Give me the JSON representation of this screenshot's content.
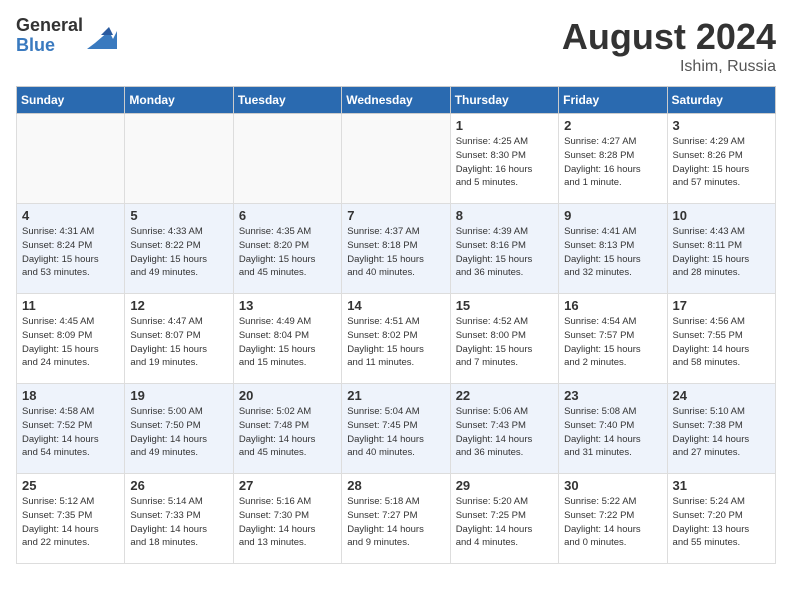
{
  "header": {
    "logo_general": "General",
    "logo_blue": "Blue",
    "month_year": "August 2024",
    "location": "Ishim, Russia"
  },
  "days_of_week": [
    "Sunday",
    "Monday",
    "Tuesday",
    "Wednesday",
    "Thursday",
    "Friday",
    "Saturday"
  ],
  "weeks": [
    [
      {
        "num": "",
        "info": ""
      },
      {
        "num": "",
        "info": ""
      },
      {
        "num": "",
        "info": ""
      },
      {
        "num": "",
        "info": ""
      },
      {
        "num": "1",
        "info": "Sunrise: 4:25 AM\nSunset: 8:30 PM\nDaylight: 16 hours\nand 5 minutes."
      },
      {
        "num": "2",
        "info": "Sunrise: 4:27 AM\nSunset: 8:28 PM\nDaylight: 16 hours\nand 1 minute."
      },
      {
        "num": "3",
        "info": "Sunrise: 4:29 AM\nSunset: 8:26 PM\nDaylight: 15 hours\nand 57 minutes."
      }
    ],
    [
      {
        "num": "4",
        "info": "Sunrise: 4:31 AM\nSunset: 8:24 PM\nDaylight: 15 hours\nand 53 minutes."
      },
      {
        "num": "5",
        "info": "Sunrise: 4:33 AM\nSunset: 8:22 PM\nDaylight: 15 hours\nand 49 minutes."
      },
      {
        "num": "6",
        "info": "Sunrise: 4:35 AM\nSunset: 8:20 PM\nDaylight: 15 hours\nand 45 minutes."
      },
      {
        "num": "7",
        "info": "Sunrise: 4:37 AM\nSunset: 8:18 PM\nDaylight: 15 hours\nand 40 minutes."
      },
      {
        "num": "8",
        "info": "Sunrise: 4:39 AM\nSunset: 8:16 PM\nDaylight: 15 hours\nand 36 minutes."
      },
      {
        "num": "9",
        "info": "Sunrise: 4:41 AM\nSunset: 8:13 PM\nDaylight: 15 hours\nand 32 minutes."
      },
      {
        "num": "10",
        "info": "Sunrise: 4:43 AM\nSunset: 8:11 PM\nDaylight: 15 hours\nand 28 minutes."
      }
    ],
    [
      {
        "num": "11",
        "info": "Sunrise: 4:45 AM\nSunset: 8:09 PM\nDaylight: 15 hours\nand 24 minutes."
      },
      {
        "num": "12",
        "info": "Sunrise: 4:47 AM\nSunset: 8:07 PM\nDaylight: 15 hours\nand 19 minutes."
      },
      {
        "num": "13",
        "info": "Sunrise: 4:49 AM\nSunset: 8:04 PM\nDaylight: 15 hours\nand 15 minutes."
      },
      {
        "num": "14",
        "info": "Sunrise: 4:51 AM\nSunset: 8:02 PM\nDaylight: 15 hours\nand 11 minutes."
      },
      {
        "num": "15",
        "info": "Sunrise: 4:52 AM\nSunset: 8:00 PM\nDaylight: 15 hours\nand 7 minutes."
      },
      {
        "num": "16",
        "info": "Sunrise: 4:54 AM\nSunset: 7:57 PM\nDaylight: 15 hours\nand 2 minutes."
      },
      {
        "num": "17",
        "info": "Sunrise: 4:56 AM\nSunset: 7:55 PM\nDaylight: 14 hours\nand 58 minutes."
      }
    ],
    [
      {
        "num": "18",
        "info": "Sunrise: 4:58 AM\nSunset: 7:52 PM\nDaylight: 14 hours\nand 54 minutes."
      },
      {
        "num": "19",
        "info": "Sunrise: 5:00 AM\nSunset: 7:50 PM\nDaylight: 14 hours\nand 49 minutes."
      },
      {
        "num": "20",
        "info": "Sunrise: 5:02 AM\nSunset: 7:48 PM\nDaylight: 14 hours\nand 45 minutes."
      },
      {
        "num": "21",
        "info": "Sunrise: 5:04 AM\nSunset: 7:45 PM\nDaylight: 14 hours\nand 40 minutes."
      },
      {
        "num": "22",
        "info": "Sunrise: 5:06 AM\nSunset: 7:43 PM\nDaylight: 14 hours\nand 36 minutes."
      },
      {
        "num": "23",
        "info": "Sunrise: 5:08 AM\nSunset: 7:40 PM\nDaylight: 14 hours\nand 31 minutes."
      },
      {
        "num": "24",
        "info": "Sunrise: 5:10 AM\nSunset: 7:38 PM\nDaylight: 14 hours\nand 27 minutes."
      }
    ],
    [
      {
        "num": "25",
        "info": "Sunrise: 5:12 AM\nSunset: 7:35 PM\nDaylight: 14 hours\nand 22 minutes."
      },
      {
        "num": "26",
        "info": "Sunrise: 5:14 AM\nSunset: 7:33 PM\nDaylight: 14 hours\nand 18 minutes."
      },
      {
        "num": "27",
        "info": "Sunrise: 5:16 AM\nSunset: 7:30 PM\nDaylight: 14 hours\nand 13 minutes."
      },
      {
        "num": "28",
        "info": "Sunrise: 5:18 AM\nSunset: 7:27 PM\nDaylight: 14 hours\nand 9 minutes."
      },
      {
        "num": "29",
        "info": "Sunrise: 5:20 AM\nSunset: 7:25 PM\nDaylight: 14 hours\nand 4 minutes."
      },
      {
        "num": "30",
        "info": "Sunrise: 5:22 AM\nSunset: 7:22 PM\nDaylight: 14 hours\nand 0 minutes."
      },
      {
        "num": "31",
        "info": "Sunrise: 5:24 AM\nSunset: 7:20 PM\nDaylight: 13 hours\nand 55 minutes."
      }
    ]
  ]
}
